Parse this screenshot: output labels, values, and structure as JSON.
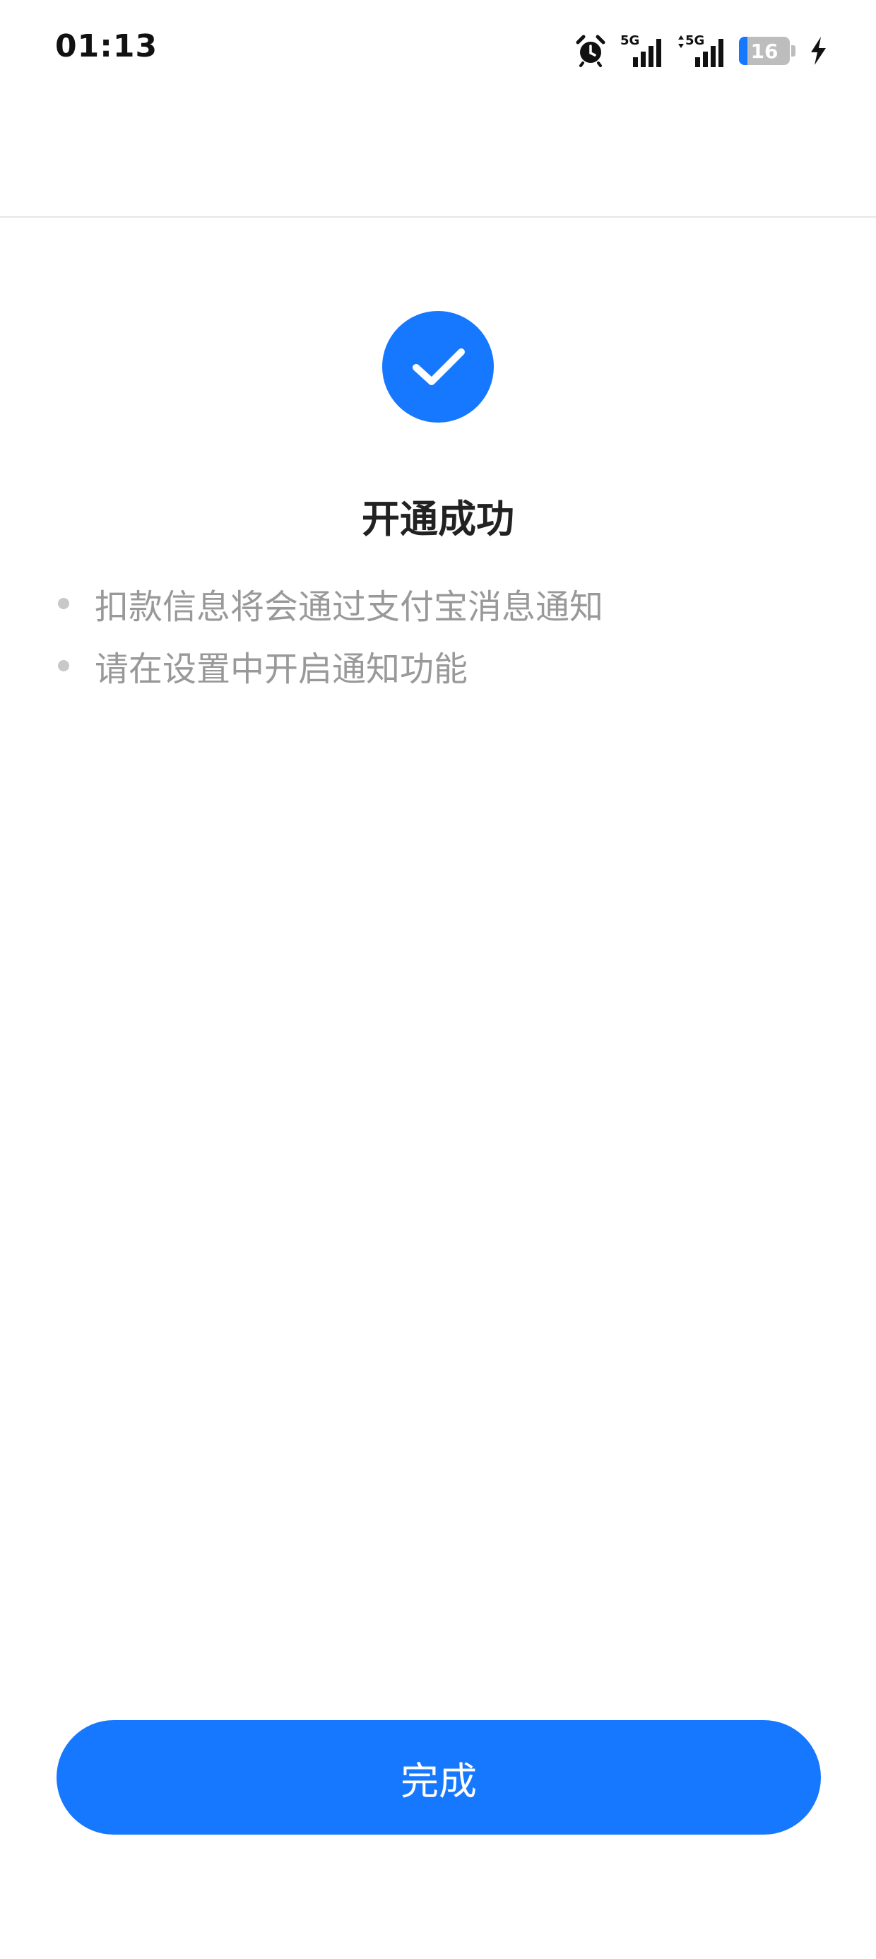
{
  "status_bar": {
    "time": "01:13",
    "network_1": "5G",
    "network_2": "5G",
    "battery_level": "16",
    "battery_fraction": 0.16,
    "icons": [
      "alarm-icon",
      "signal-5g-icon",
      "signal-5g-data-icon",
      "battery-icon",
      "charging-icon"
    ]
  },
  "colors": {
    "accent": "#1677ff",
    "title": "#222222",
    "note_text": "#999999"
  },
  "result": {
    "icon": "checkmark-icon",
    "title": "开通成功",
    "notes": [
      "扣款信息将会通过支付宝消息通知",
      "请在设置中开启通知功能"
    ]
  },
  "actions": {
    "done_label": "完成"
  }
}
